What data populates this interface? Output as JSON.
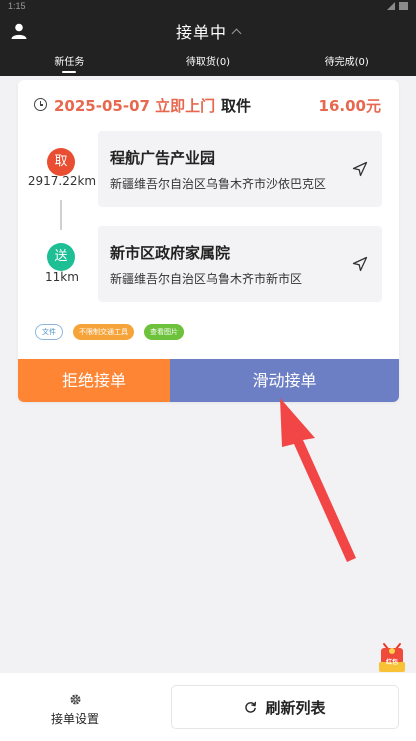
{
  "status_bar": {
    "time": "1:15"
  },
  "header": {
    "title": "接单中",
    "tabs": [
      {
        "label": "新任务"
      },
      {
        "label": "待取货(0)"
      },
      {
        "label": "待完成(0)"
      }
    ]
  },
  "task": {
    "pickup_time": "2025-05-07 立即上门",
    "pickup_kind": "取件",
    "price": "16.00元",
    "pickup": {
      "marker": "取",
      "distance": "2917.22km",
      "name": "程航广告产业园",
      "address": "新疆维吾尔自治区乌鲁木齐市沙依巴克区"
    },
    "dropoff": {
      "marker": "送",
      "distance": "11km",
      "name": "新市区政府家属院",
      "address": "新疆维吾尔自治区乌鲁木齐市新市区"
    },
    "tags": [
      "文件",
      "不限制交通工具",
      "查看图片"
    ],
    "reject_label": "拒绝接单",
    "accept_label": "滑动接单"
  },
  "red_packet": {
    "label": "红包"
  },
  "bottom": {
    "settings_label": "接单设置",
    "refresh_label": "刷新列表"
  },
  "colors": {
    "header_bg": "#222222",
    "accent_orange": "#fe8534",
    "accept_blue": "#6d7fc4",
    "price_red": "#e8674f",
    "pickup_marker": "#e94e32",
    "dropoff_marker": "#1fbf95",
    "annotation_arrow": "#f24545"
  },
  "icons": [
    "user-icon",
    "chevron-up-icon",
    "clock-icon",
    "navigate-icon",
    "gear-icon",
    "refresh-icon",
    "red-packet-icon"
  ]
}
